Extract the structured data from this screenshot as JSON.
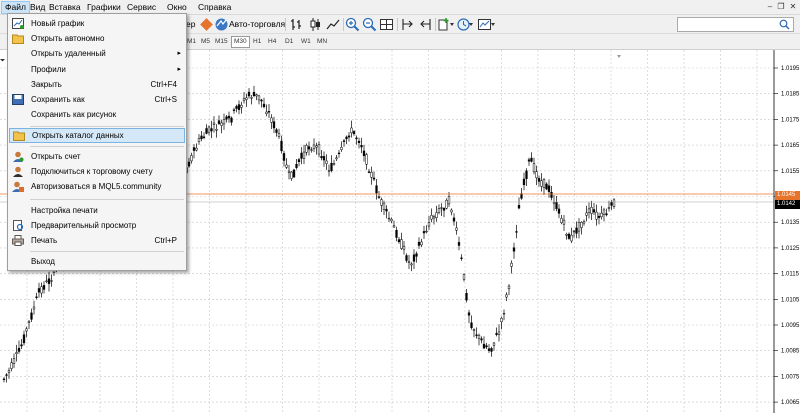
{
  "menubar": {
    "items": [
      "Файл",
      "Вид",
      "Вставка",
      "Графики",
      "Сервис",
      "Окно",
      "Справка"
    ],
    "active_index": 0
  },
  "toolbar": {
    "partial_label": "ер",
    "autotrading_label": "Авто-торговля"
  },
  "timeframes": {
    "items": [
      "M1",
      "M5",
      "M15",
      "M30",
      "H1",
      "H4",
      "D1",
      "W1",
      "MN"
    ],
    "active": "M30"
  },
  "file_menu": {
    "items": [
      {
        "label": "Новый график",
        "icon": "new-chart-icon"
      },
      {
        "label": "Открыть автономно",
        "icon": "open-offline-icon"
      },
      {
        "label": "Открыть удаленный",
        "submenu": true
      },
      {
        "label": "Профили",
        "submenu": true
      },
      {
        "label": "Закрыть",
        "shortcut": "Ctrl+F4"
      },
      {
        "label": "Сохранить как",
        "shortcut": "Ctrl+S",
        "icon": "save-icon"
      },
      {
        "label": "Сохранить как рисунок"
      },
      {
        "label": "Открыть каталог данных",
        "icon": "folder-icon",
        "highlighted": true
      },
      {
        "label": "Открыть счет",
        "icon": "account-icon"
      },
      {
        "label": "Подключиться к торговому счету",
        "icon": "connect-icon"
      },
      {
        "label": "Авторизоваться в MQL5.community",
        "icon": "mql5-icon"
      },
      {
        "label": "Настройка печати"
      },
      {
        "label": "Предварительный просмотр",
        "icon": "print-preview-icon"
      },
      {
        "label": "Печать",
        "shortcut": "Ctrl+P",
        "icon": "print-icon"
      },
      {
        "label": "Выход"
      }
    ]
  },
  "chart": {
    "price_axis": [
      "1.0195",
      "1.0185",
      "1.0175",
      "1.0165",
      "1.0155",
      "1.0145",
      "1.0135",
      "1.0125",
      "1.0115",
      "1.0105",
      "1.0095",
      "1.0085",
      "1.0075",
      "1.0065"
    ],
    "ask_price": "1.0145",
    "bid_price": "1.0142",
    "ask_line_color": "#e8742c",
    "bid_line_color": "#a6a6a6",
    "grid_color": "#c8c8c8"
  }
}
